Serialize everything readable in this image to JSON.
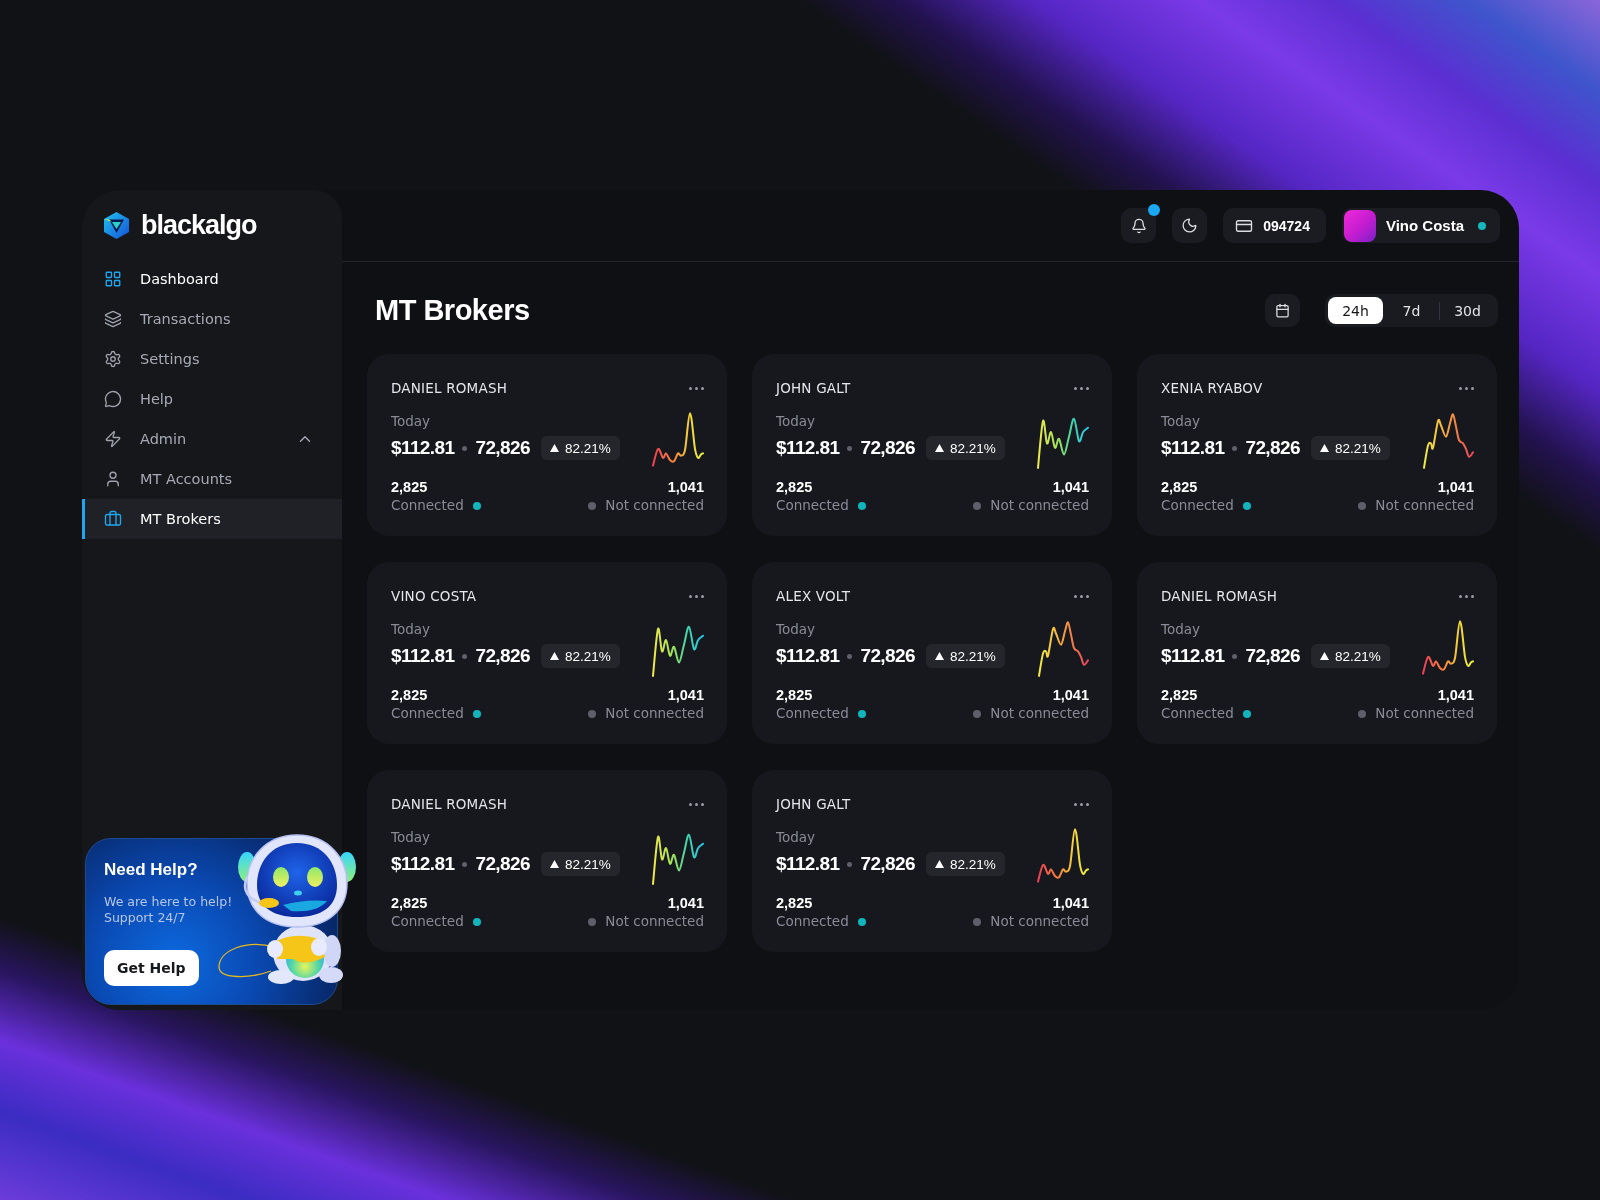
{
  "brand": {
    "name": "blackalgo"
  },
  "sidebar": {
    "items": [
      {
        "label": "Dashboard",
        "highlighted": true,
        "selected": false
      },
      {
        "label": "Transactions",
        "highlighted": false,
        "selected": false
      },
      {
        "label": "Settings",
        "highlighted": false,
        "selected": false
      },
      {
        "label": "Help",
        "highlighted": false,
        "selected": false
      },
      {
        "label": "Admin",
        "highlighted": false,
        "selected": false,
        "expanded": true,
        "children": [
          {
            "label": "MT Accounts",
            "highlighted": false,
            "selected": false
          },
          {
            "label": "MT Brokers",
            "highlighted": true,
            "selected": true
          }
        ]
      }
    ]
  },
  "help_card": {
    "title": "Need Help?",
    "text": "We are here to help! Support 24/7",
    "button": "Get Help"
  },
  "header": {
    "notifications": {
      "unread": true
    },
    "account_id": "094724",
    "user": {
      "name": "Vino Costa",
      "online": true
    }
  },
  "page": {
    "title": "MT Brokers",
    "ranges": [
      {
        "label": "24h",
        "selected": true
      },
      {
        "label": "7d",
        "selected": false
      },
      {
        "label": "30d",
        "selected": false
      }
    ]
  },
  "brokers": [
    {
      "name": "DANIEL ROMASH",
      "kind": "spike",
      "period": "Today",
      "amount": "$112.81",
      "volume": "72,826",
      "change": "82.21%",
      "statuses": [
        {
          "count": "2,825",
          "label": "Connected",
          "color": "#13b5bd"
        },
        {
          "count": "1,041",
          "label": "Not connected",
          "color": "#5e5f69"
        }
      ]
    },
    {
      "name": "JOHN GALT",
      "kind": "wave",
      "period": "Today",
      "amount": "$112.81",
      "volume": "72,826",
      "change": "82.21%",
      "statuses": [
        {
          "count": "2,825",
          "label": "Connected",
          "color": "#13b5bd"
        },
        {
          "count": "1,041",
          "label": "Not connected",
          "color": "#5e5f69"
        }
      ]
    },
    {
      "name": "XENIA RYABOV",
      "kind": "peaks",
      "period": "Today",
      "amount": "$112.81",
      "volume": "72,826",
      "change": "82.21%",
      "statuses": [
        {
          "count": "2,825",
          "label": "Connected",
          "color": "#13b5bd"
        },
        {
          "count": "1,041",
          "label": "Not connected",
          "color": "#5e5f69"
        }
      ]
    },
    {
      "name": "VINO COSTA",
      "kind": "wave",
      "period": "Today",
      "amount": "$112.81",
      "volume": "72,826",
      "change": "82.21%",
      "statuses": [
        {
          "count": "2,825",
          "label": "Connected",
          "color": "#13b5bd"
        },
        {
          "count": "1,041",
          "label": "Not connected",
          "color": "#5e5f69"
        }
      ]
    },
    {
      "name": "ALEX VOLT",
      "kind": "peaks",
      "period": "Today",
      "amount": "$112.81",
      "volume": "72,826",
      "change": "82.21%",
      "statuses": [
        {
          "count": "2,825",
          "label": "Connected",
          "color": "#13b5bd"
        },
        {
          "count": "1,041",
          "label": "Not connected",
          "color": "#5e5f69"
        }
      ]
    },
    {
      "name": "DANIEL ROMASH",
      "kind": "spike",
      "period": "Today",
      "amount": "$112.81",
      "volume": "72,826",
      "change": "82.21%",
      "statuses": [
        {
          "count": "2,825",
          "label": "Connected",
          "color": "#13b5bd"
        },
        {
          "count": "1,041",
          "label": "Not connected",
          "color": "#5e5f69"
        }
      ]
    },
    {
      "name": "DANIEL ROMASH",
      "kind": "wave",
      "period": "Today",
      "amount": "$112.81",
      "volume": "72,826",
      "change": "82.21%",
      "statuses": [
        {
          "count": "2,825",
          "label": "Connected",
          "color": "#13b5bd"
        },
        {
          "count": "1,041",
          "label": "Not connected",
          "color": "#5e5f69"
        }
      ]
    },
    {
      "name": "JOHN GALT",
      "kind": "spike",
      "period": "Today",
      "amount": "$112.81",
      "volume": "72,826",
      "change": "82.21%",
      "statuses": [
        {
          "count": "2,825",
          "label": "Connected",
          "color": "#13b5bd"
        },
        {
          "count": "1,041",
          "label": "Not connected",
          "color": "#5e5f69"
        }
      ]
    }
  ]
}
